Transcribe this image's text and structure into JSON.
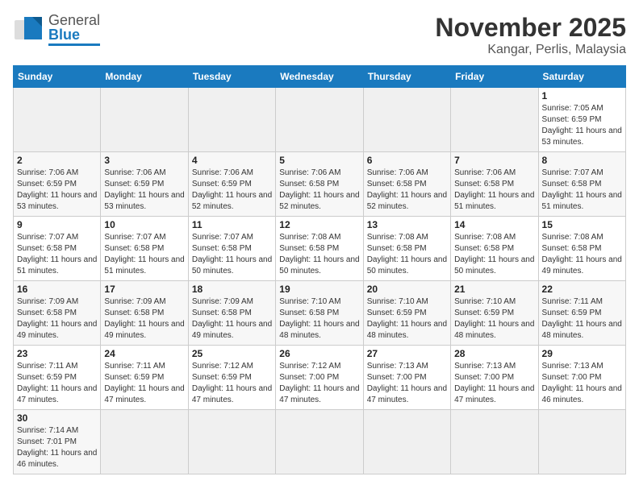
{
  "header": {
    "logo_general": "General",
    "logo_blue": "Blue",
    "title": "November 2025",
    "subtitle": "Kangar, Perlis, Malaysia"
  },
  "weekdays": [
    "Sunday",
    "Monday",
    "Tuesday",
    "Wednesday",
    "Thursday",
    "Friday",
    "Saturday"
  ],
  "weeks": [
    [
      {
        "day": "",
        "empty": true
      },
      {
        "day": "",
        "empty": true
      },
      {
        "day": "",
        "empty": true
      },
      {
        "day": "",
        "empty": true
      },
      {
        "day": "",
        "empty": true
      },
      {
        "day": "",
        "empty": true
      },
      {
        "day": "1",
        "sunrise": "Sunrise: 7:05 AM",
        "sunset": "Sunset: 6:59 PM",
        "daylight": "Daylight: 11 hours and 53 minutes."
      }
    ],
    [
      {
        "day": "2",
        "sunrise": "Sunrise: 7:06 AM",
        "sunset": "Sunset: 6:59 PM",
        "daylight": "Daylight: 11 hours and 53 minutes."
      },
      {
        "day": "3",
        "sunrise": "Sunrise: 7:06 AM",
        "sunset": "Sunset: 6:59 PM",
        "daylight": "Daylight: 11 hours and 53 minutes."
      },
      {
        "day": "4",
        "sunrise": "Sunrise: 7:06 AM",
        "sunset": "Sunset: 6:59 PM",
        "daylight": "Daylight: 11 hours and 52 minutes."
      },
      {
        "day": "5",
        "sunrise": "Sunrise: 7:06 AM",
        "sunset": "Sunset: 6:58 PM",
        "daylight": "Daylight: 11 hours and 52 minutes."
      },
      {
        "day": "6",
        "sunrise": "Sunrise: 7:06 AM",
        "sunset": "Sunset: 6:58 PM",
        "daylight": "Daylight: 11 hours and 52 minutes."
      },
      {
        "day": "7",
        "sunrise": "Sunrise: 7:06 AM",
        "sunset": "Sunset: 6:58 PM",
        "daylight": "Daylight: 11 hours and 51 minutes."
      },
      {
        "day": "8",
        "sunrise": "Sunrise: 7:07 AM",
        "sunset": "Sunset: 6:58 PM",
        "daylight": "Daylight: 11 hours and 51 minutes."
      }
    ],
    [
      {
        "day": "9",
        "sunrise": "Sunrise: 7:07 AM",
        "sunset": "Sunset: 6:58 PM",
        "daylight": "Daylight: 11 hours and 51 minutes."
      },
      {
        "day": "10",
        "sunrise": "Sunrise: 7:07 AM",
        "sunset": "Sunset: 6:58 PM",
        "daylight": "Daylight: 11 hours and 51 minutes."
      },
      {
        "day": "11",
        "sunrise": "Sunrise: 7:07 AM",
        "sunset": "Sunset: 6:58 PM",
        "daylight": "Daylight: 11 hours and 50 minutes."
      },
      {
        "day": "12",
        "sunrise": "Sunrise: 7:08 AM",
        "sunset": "Sunset: 6:58 PM",
        "daylight": "Daylight: 11 hours and 50 minutes."
      },
      {
        "day": "13",
        "sunrise": "Sunrise: 7:08 AM",
        "sunset": "Sunset: 6:58 PM",
        "daylight": "Daylight: 11 hours and 50 minutes."
      },
      {
        "day": "14",
        "sunrise": "Sunrise: 7:08 AM",
        "sunset": "Sunset: 6:58 PM",
        "daylight": "Daylight: 11 hours and 50 minutes."
      },
      {
        "day": "15",
        "sunrise": "Sunrise: 7:08 AM",
        "sunset": "Sunset: 6:58 PM",
        "daylight": "Daylight: 11 hours and 49 minutes."
      }
    ],
    [
      {
        "day": "16",
        "sunrise": "Sunrise: 7:09 AM",
        "sunset": "Sunset: 6:58 PM",
        "daylight": "Daylight: 11 hours and 49 minutes."
      },
      {
        "day": "17",
        "sunrise": "Sunrise: 7:09 AM",
        "sunset": "Sunset: 6:58 PM",
        "daylight": "Daylight: 11 hours and 49 minutes."
      },
      {
        "day": "18",
        "sunrise": "Sunrise: 7:09 AM",
        "sunset": "Sunset: 6:58 PM",
        "daylight": "Daylight: 11 hours and 49 minutes."
      },
      {
        "day": "19",
        "sunrise": "Sunrise: 7:10 AM",
        "sunset": "Sunset: 6:58 PM",
        "daylight": "Daylight: 11 hours and 48 minutes."
      },
      {
        "day": "20",
        "sunrise": "Sunrise: 7:10 AM",
        "sunset": "Sunset: 6:59 PM",
        "daylight": "Daylight: 11 hours and 48 minutes."
      },
      {
        "day": "21",
        "sunrise": "Sunrise: 7:10 AM",
        "sunset": "Sunset: 6:59 PM",
        "daylight": "Daylight: 11 hours and 48 minutes."
      },
      {
        "day": "22",
        "sunrise": "Sunrise: 7:11 AM",
        "sunset": "Sunset: 6:59 PM",
        "daylight": "Daylight: 11 hours and 48 minutes."
      }
    ],
    [
      {
        "day": "23",
        "sunrise": "Sunrise: 7:11 AM",
        "sunset": "Sunset: 6:59 PM",
        "daylight": "Daylight: 11 hours and 47 minutes."
      },
      {
        "day": "24",
        "sunrise": "Sunrise: 7:11 AM",
        "sunset": "Sunset: 6:59 PM",
        "daylight": "Daylight: 11 hours and 47 minutes."
      },
      {
        "day": "25",
        "sunrise": "Sunrise: 7:12 AM",
        "sunset": "Sunset: 6:59 PM",
        "daylight": "Daylight: 11 hours and 47 minutes."
      },
      {
        "day": "26",
        "sunrise": "Sunrise: 7:12 AM",
        "sunset": "Sunset: 7:00 PM",
        "daylight": "Daylight: 11 hours and 47 minutes."
      },
      {
        "day": "27",
        "sunrise": "Sunrise: 7:13 AM",
        "sunset": "Sunset: 7:00 PM",
        "daylight": "Daylight: 11 hours and 47 minutes."
      },
      {
        "day": "28",
        "sunrise": "Sunrise: 7:13 AM",
        "sunset": "Sunset: 7:00 PM",
        "daylight": "Daylight: 11 hours and 47 minutes."
      },
      {
        "day": "29",
        "sunrise": "Sunrise: 7:13 AM",
        "sunset": "Sunset: 7:00 PM",
        "daylight": "Daylight: 11 hours and 46 minutes."
      }
    ],
    [
      {
        "day": "30",
        "sunrise": "Sunrise: 7:14 AM",
        "sunset": "Sunset: 7:01 PM",
        "daylight": "Daylight: 11 hours and 46 minutes."
      },
      {
        "day": "",
        "empty": true
      },
      {
        "day": "",
        "empty": true
      },
      {
        "day": "",
        "empty": true
      },
      {
        "day": "",
        "empty": true
      },
      {
        "day": "",
        "empty": true
      },
      {
        "day": "",
        "empty": true
      }
    ]
  ]
}
